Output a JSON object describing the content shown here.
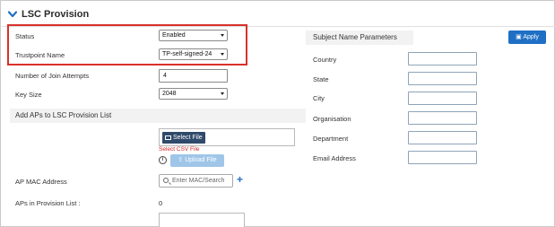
{
  "section": {
    "title": "LSC Provision"
  },
  "left": {
    "status_label": "Status",
    "status_value": "Enabled",
    "trustpoint_label": "Trustpoint Name",
    "trustpoint_value": "TP-self-signed-24",
    "join_attempts_label": "Number of Join Attempts",
    "join_attempts_value": "4",
    "key_size_label": "Key Size",
    "key_size_value": "2048",
    "add_aps_header": "Add APs to LSC Provision List",
    "select_file_label": "Select File",
    "csv_note": "Select CSV File",
    "info_glyph": "i",
    "upload_label": "Upload File",
    "ap_mac_label": "AP MAC Address",
    "search_placeholder": "Enter MAC/Search",
    "add_glyph": "+",
    "aps_in_list_label": "APs in Provision List :",
    "aps_in_list_count": "0"
  },
  "right": {
    "header": "Subject Name Parameters",
    "apply_label": "Apply",
    "fields": [
      {
        "label": "Country",
        "value": ""
      },
      {
        "label": "State",
        "value": ""
      },
      {
        "label": "City",
        "value": ""
      },
      {
        "label": "Organisation",
        "value": ""
      },
      {
        "label": "Department",
        "value": ""
      },
      {
        "label": "Email Address",
        "value": ""
      }
    ]
  },
  "colors": {
    "accent": "#1f6fc5",
    "highlight_box": "#d9312b",
    "note_red": "#d62828",
    "upload_disabled": "#9fc6e8",
    "select_file_button": "#2f4a6a"
  },
  "icons": [
    "chevron-down-icon",
    "folder-icon",
    "info-icon",
    "upload-icon",
    "search-icon",
    "plus-icon",
    "save-icon"
  ]
}
